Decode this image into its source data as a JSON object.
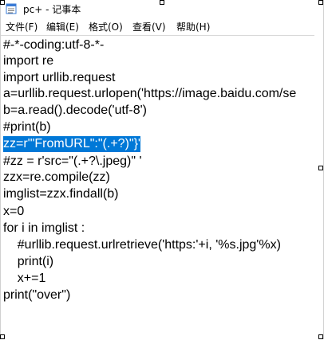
{
  "window": {
    "title": "pc+ - 记事本"
  },
  "menu": {
    "items": [
      "文件(F)",
      "编辑(E)",
      "格式(O)",
      "查看(V)",
      "帮助(H)"
    ]
  },
  "editor": {
    "lines": [
      "#-*-coding:utf-8-*-",
      "import re",
      "import urllib.request",
      "a=urllib.request.urlopen('https://image.baidu.com/se",
      "b=a.read().decode('utf-8')",
      "#print(b)",
      "zz=r'\"FromURL\":\"(.+?)\"}'",
      "#zz = r'src=\"(.+?\\.jpeg)\" '",
      "zzx=re.compile(zz)",
      "imglist=zzx.findall(b)",
      "x=0",
      "for i in imglist :",
      "    #urllib.request.urlretrieve('https:'+i, '%s.jpg'%x)",
      "    print(i)",
      "    x+=1",
      "print(\"over\")"
    ],
    "selected_line_index": 6
  },
  "colors": {
    "selection": "#0078d7",
    "text": "#000000",
    "background": "#ffffff"
  }
}
